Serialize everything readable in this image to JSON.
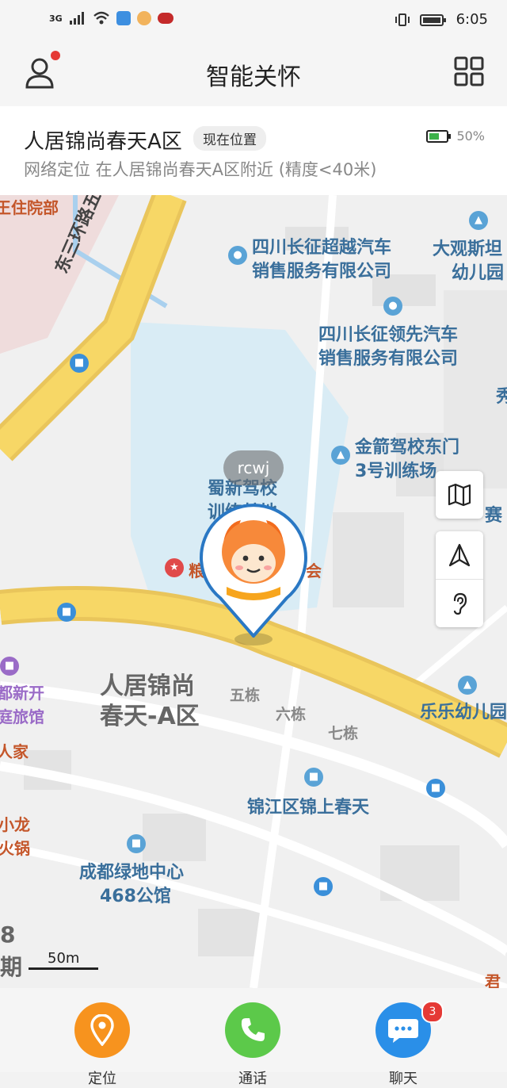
{
  "status_bar": {
    "network": "3G",
    "battery_icon": "battery-icon",
    "time": "6:05"
  },
  "header": {
    "title": "智能关怀"
  },
  "location": {
    "name": "人居锦尚春天A区",
    "current_tag": "现在位置",
    "battery_percent": "50%",
    "detail": "网络定位  在人居锦尚春天A区附近 (精度<40米)"
  },
  "map": {
    "marker_label": "rcwj",
    "scale_label": "50m",
    "labels": {
      "hospital": "王住院部",
      "road_east": "东三环路五段",
      "poi_sichuan_chaoyue_1": "四川长征超越汽车",
      "poi_sichuan_chaoyue_2": "销售服务有限公司",
      "poi_daguan_1": "大观斯坦",
      "poi_daguan_2": "幼儿园",
      "poi_sichuan_lingxian_1": "四川长征领先汽车",
      "poi_sichuan_lingxian_2": "销售服务有限公司",
      "poi_xiu": "秀",
      "poi_jinjian_1": "金箭驾校东门",
      "poi_jinjian_2": "3号训练场",
      "poi_sai": "赛",
      "poi_shuxin_1": "蜀新驾校",
      "poi_shuxin_2": "训练基地",
      "poi_liang": "粮",
      "poi_hui": "会",
      "poi_renju_1": "人居锦尚",
      "poi_renju_2": "春天-A区",
      "bldg_5": "五栋",
      "bldg_6": "六栋",
      "bldg_7": "七栋",
      "poi_lele": "乐乐幼儿园",
      "poi_dudu_1": "都新开",
      "poi_dudu_2": "庭旅馆",
      "poi_renjia": "人家",
      "poi_jinjiang": "锦江区锦上春天",
      "poi_xiaolong_1": "小龙",
      "poi_xiaolong_2": "火锅",
      "poi_lvdi_1": "成都绿地中心",
      "poi_lvdi_2": "468公馆",
      "poi_8": "8",
      "poi_qi": "期",
      "poi_jun": "君"
    }
  },
  "bottom_nav": {
    "locate_label": "定位",
    "call_label": "通话",
    "chat_label": "聊天",
    "chat_badge": "3",
    "colors": {
      "locate": "#f7931e",
      "call": "#5cc94a",
      "chat": "#2a8fe8"
    }
  }
}
